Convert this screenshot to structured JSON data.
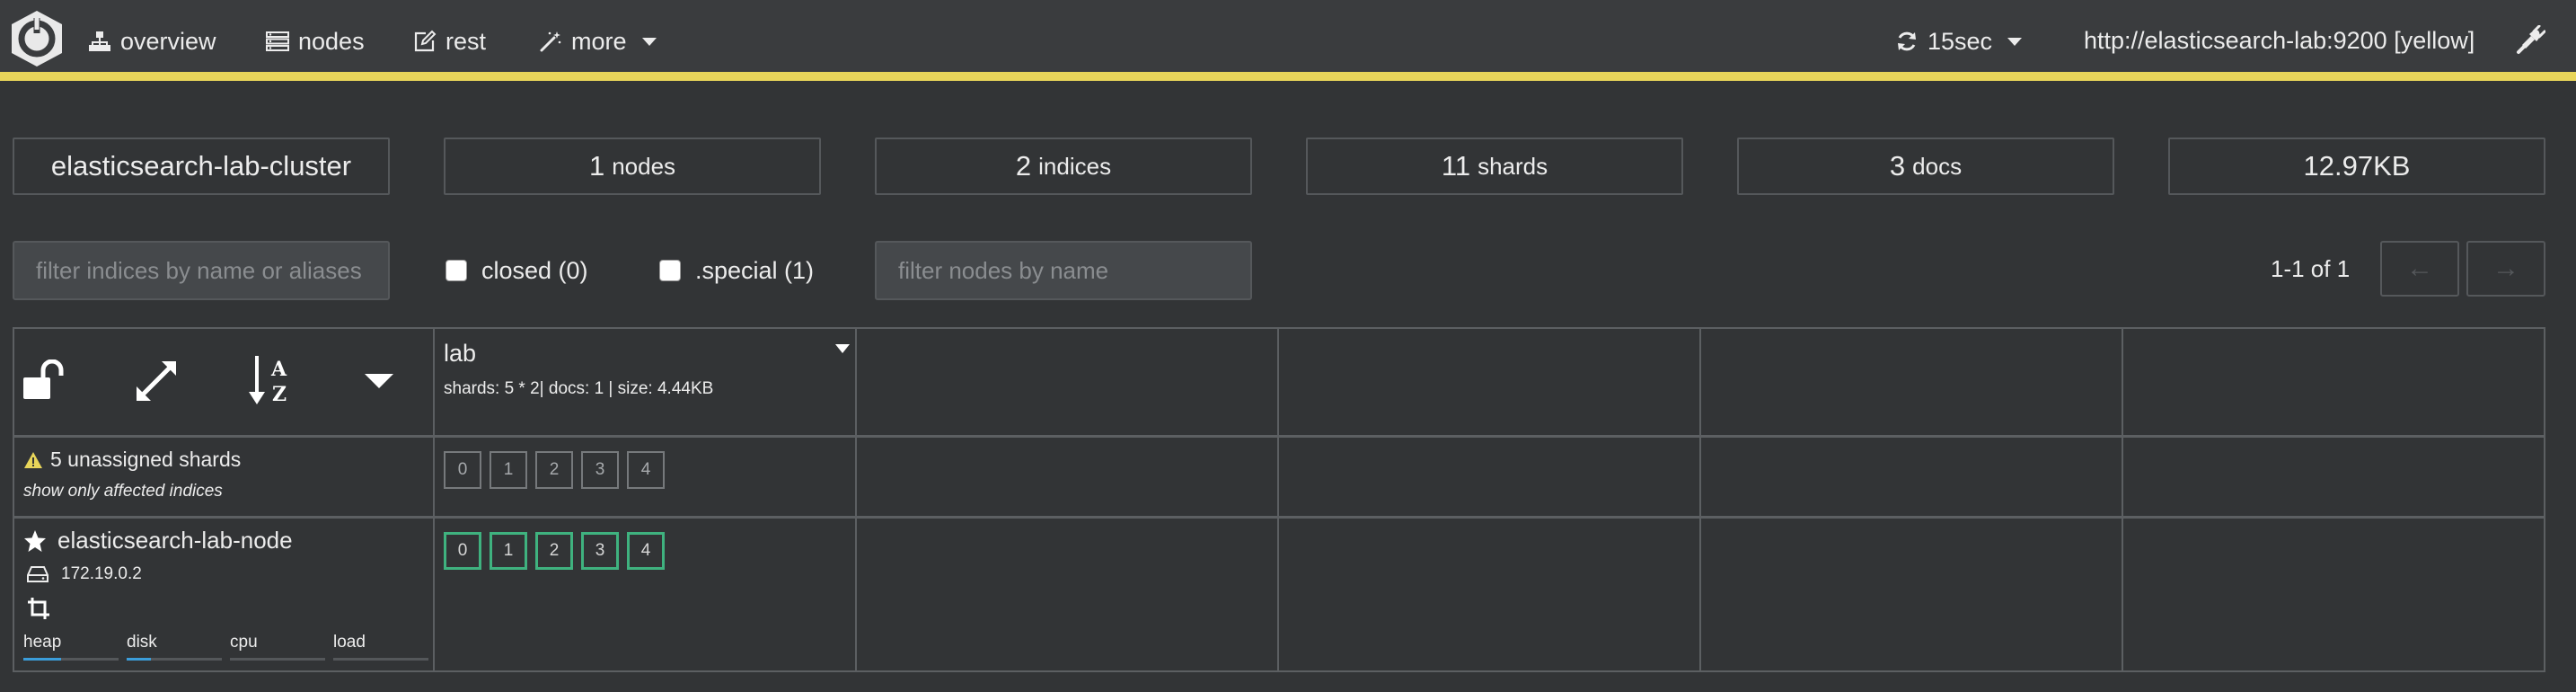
{
  "nav": {
    "items": [
      {
        "label": "overview",
        "icon": "sitemap-icon"
      },
      {
        "label": "nodes",
        "icon": "server-icon"
      },
      {
        "label": "rest",
        "icon": "edit-icon"
      },
      {
        "label": "more",
        "icon": "magic-wand-icon"
      }
    ],
    "refresh_interval": "15sec",
    "cluster_url": "http://elasticsearch-lab:9200 [yellow]"
  },
  "colors": {
    "status_bar": "#e8d55a",
    "shard_started": "#3fb27f",
    "metric_bar": "#3b9dda",
    "background": "#323436"
  },
  "stats": {
    "cluster_name": "elasticsearch-lab-cluster",
    "nodes_num": "1",
    "nodes_label": "nodes",
    "indices_num": "2",
    "indices_label": "indices",
    "shards_num": "11",
    "shards_label": "shards",
    "docs_num": "3",
    "docs_label": "docs",
    "size": "12.97KB"
  },
  "filters": {
    "indices_placeholder": "filter indices by name or aliases",
    "closed_label": "closed (0)",
    "special_label": ".special (1)",
    "nodes_placeholder": "filter nodes by name",
    "pagination": "1-1 of 1",
    "prev_label": "←",
    "next_label": "→"
  },
  "index": {
    "name": "lab",
    "meta": "shards: 5 * 2| docs: 1 | size: 4.44KB",
    "unassigned_shards": [
      "0",
      "1",
      "2",
      "3",
      "4"
    ]
  },
  "unassigned": {
    "label": "5 unassigned shards",
    "link": "show only affected indices"
  },
  "node": {
    "name": "elasticsearch-lab-node",
    "ip": "172.19.0.2",
    "shards": [
      "0",
      "1",
      "2",
      "3",
      "4"
    ],
    "metrics": [
      {
        "label": "heap",
        "fill": 0.4
      },
      {
        "label": "disk",
        "fill": 0.25
      },
      {
        "label": "cpu",
        "fill": 0
      },
      {
        "label": "load",
        "fill": 0
      }
    ]
  }
}
